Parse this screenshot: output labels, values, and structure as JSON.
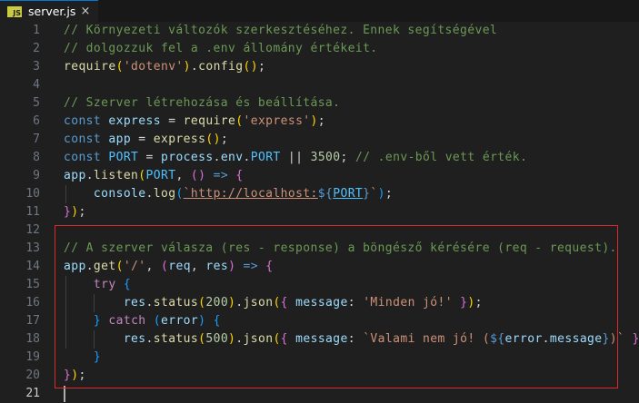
{
  "tab": {
    "icon_text": "JS",
    "filename": "server.js",
    "close_glyph": "×"
  },
  "line_numbers": [
    "1",
    "2",
    "3",
    "4",
    "5",
    "6",
    "7",
    "8",
    "9",
    "10",
    "11",
    "12",
    "13",
    "14",
    "15",
    "16",
    "17",
    "18",
    "19",
    "20",
    "21"
  ],
  "highlight_color": "#d92b2b",
  "code": {
    "l1": "// Környezeti változók szerkesztéséhez. Ennek segítségével",
    "l2": "// dolgozzuk fel a .env állomány értékeit.",
    "l3": {
      "fn": "require",
      "arg": "'dotenv'",
      "method": "config"
    },
    "l5": "// Szerver létrehozása és beállítása.",
    "l6": {
      "kw": "const",
      "name": "express",
      "fn": "require",
      "arg": "'express'"
    },
    "l7": {
      "kw": "const",
      "name": "app",
      "fn": "express"
    },
    "l8": {
      "kw": "const",
      "name": "PORT",
      "obj": "process",
      "prop": "env",
      "const": "PORT",
      "op": "||",
      "num": "3500",
      "comment": "// .env-ből vett érték."
    },
    "l9": {
      "obj": "app",
      "fn": "listen",
      "arg": "PORT",
      "arrow": "=>"
    },
    "l10": {
      "obj": "console",
      "fn": "log",
      "str": "`http://localhost:",
      "tpl_open": "${",
      "var": "PORT",
      "tpl_close": "}",
      "str_end": "`"
    },
    "l13": "// A szerver válasza (res - response) a böngésző kérésére (req - request).",
    "l14": {
      "obj": "app",
      "fn": "get",
      "arg": "'/'",
      "p1": "req",
      "p2": "res",
      "arrow": "=>"
    },
    "l15": {
      "kw": "try"
    },
    "l16": {
      "obj": "res",
      "fn1": "status",
      "num": "200",
      "fn2": "json",
      "key": "message",
      "str": "'Minden jó!'"
    },
    "l17": {
      "kw": "catch",
      "param": "error"
    },
    "l18": {
      "obj": "res",
      "fn1": "status",
      "num": "500",
      "fn2": "json",
      "key": "message",
      "str1": "`Valami nem jó! (",
      "tpl_open": "${",
      "v1": "error",
      "v2": "message",
      "tpl_close": "}",
      "str2": ")`"
    }
  }
}
